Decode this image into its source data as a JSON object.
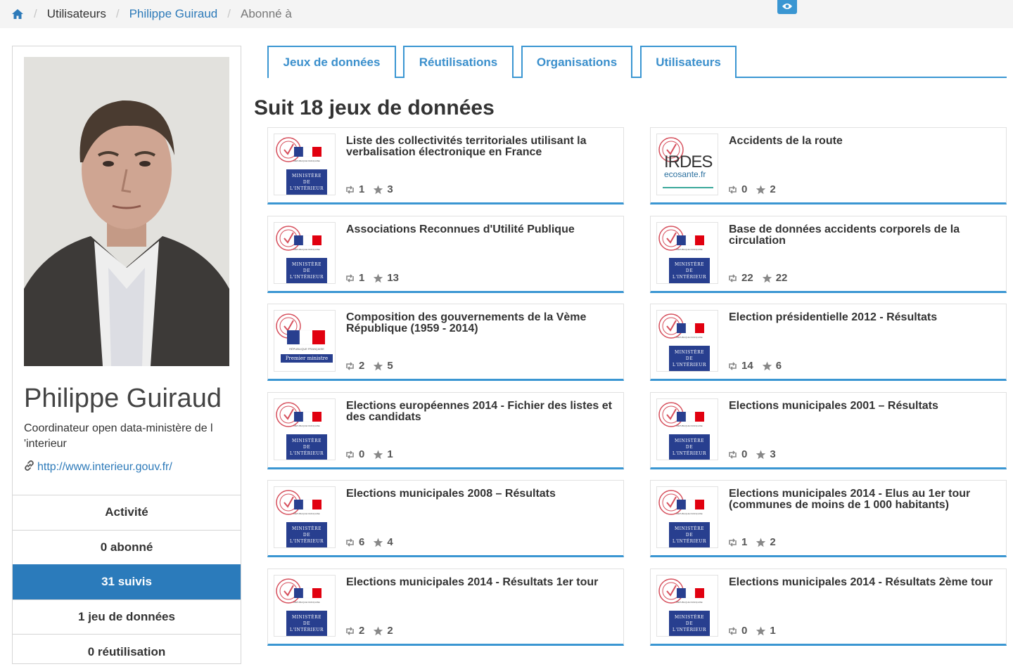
{
  "breadcrumb": {
    "items": [
      "Utilisateurs",
      "Philippe Guiraud",
      "Abonné à"
    ]
  },
  "profile": {
    "name": "Philippe Guiraud",
    "description": "Coordinateur open data-ministère de l 'interieur",
    "url": "http://www.interieur.gouv.fr/"
  },
  "side_menu": [
    {
      "label": "Activité"
    },
    {
      "label": "0 abonné"
    },
    {
      "label": "31 suivis"
    },
    {
      "label": "1 jeu de données"
    },
    {
      "label": "0 réutilisation"
    }
  ],
  "tabs": [
    {
      "label": "Jeux de données"
    },
    {
      "label": "Réutilisations"
    },
    {
      "label": "Organisations"
    },
    {
      "label": "Utilisateurs"
    }
  ],
  "heading": "Suit 18 jeux de données",
  "logos": {
    "mi": "MINISTÈRE DE L'INTÉRIEUR",
    "pm": "Premier ministre",
    "rf": "RÉPUBLIQUE FRANÇAISE",
    "irdes": "IRDES",
    "irdes_sub": "ecosante.fr"
  },
  "datasets": [
    {
      "title": "Liste des collectivités territoriales utilisant la verbalisation électronique en France",
      "reuses": "1",
      "stars": "3",
      "logo": "mi"
    },
    {
      "title": "Accidents de la route",
      "reuses": "0",
      "stars": "2",
      "logo": "irdes"
    },
    {
      "title": "Associations Reconnues d'Utilité Publique",
      "reuses": "1",
      "stars": "13",
      "logo": "mi"
    },
    {
      "title": "Base de données accidents corporels de la circulation",
      "reuses": "22",
      "stars": "22",
      "logo": "mi"
    },
    {
      "title": "Composition des gouvernements de la Vème République (1959 - 2014)",
      "reuses": "2",
      "stars": "5",
      "logo": "pm"
    },
    {
      "title": "Election présidentielle 2012 - Résultats",
      "reuses": "14",
      "stars": "6",
      "logo": "mi"
    },
    {
      "title": "Elections européennes 2014 - Fichier des listes et des candidats",
      "reuses": "0",
      "stars": "1",
      "logo": "mi"
    },
    {
      "title": "Elections municipales 2001 – Résultats",
      "reuses": "0",
      "stars": "3",
      "logo": "mi"
    },
    {
      "title": "Elections municipales 2008 – Résultats",
      "reuses": "6",
      "stars": "4",
      "logo": "mi"
    },
    {
      "title": "Elections municipales 2014 - Elus au 1er tour (communes de moins de 1 000 habitants)",
      "reuses": "1",
      "stars": "2",
      "logo": "mi"
    },
    {
      "title": "Elections municipales 2014 - Résultats 1er tour",
      "reuses": "2",
      "stars": "2",
      "logo": "mi"
    },
    {
      "title": "Elections municipales 2014 - Résultats 2ème tour",
      "reuses": "0",
      "stars": "1",
      "logo": "mi"
    }
  ],
  "colors": {
    "accent": "#3a96d2",
    "active_menu": "#2b7bbb",
    "link": "#2d7ab9"
  }
}
